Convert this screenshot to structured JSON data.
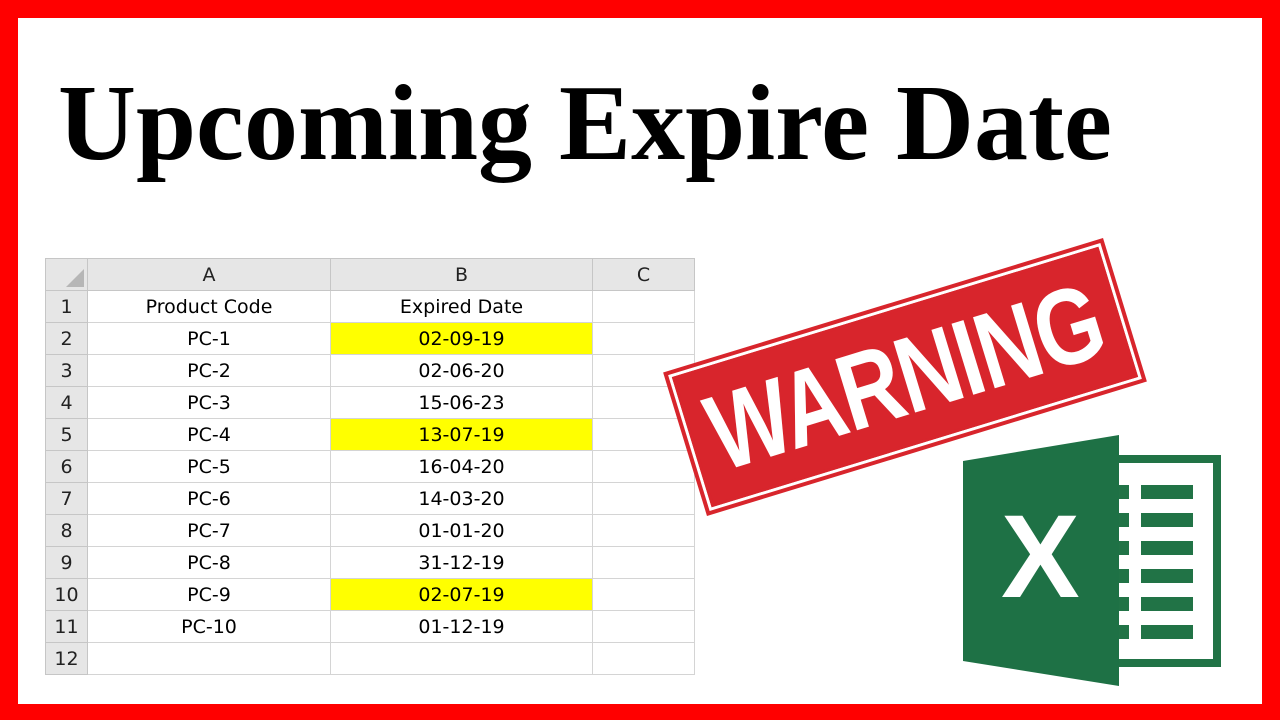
{
  "title": "Upcoming Expire Date",
  "sheet": {
    "columns": [
      "A",
      "B",
      "C"
    ],
    "header_row": {
      "num": "1",
      "a": "Product Code",
      "b": "Expired Date",
      "c": ""
    },
    "rows": [
      {
        "num": "2",
        "code": "PC-1",
        "date": "02-09-19",
        "highlight": true
      },
      {
        "num": "3",
        "code": "PC-2",
        "date": "02-06-20",
        "highlight": false
      },
      {
        "num": "4",
        "code": "PC-3",
        "date": "15-06-23",
        "highlight": false
      },
      {
        "num": "5",
        "code": "PC-4",
        "date": "13-07-19",
        "highlight": true
      },
      {
        "num": "6",
        "code": "PC-5",
        "date": "16-04-20",
        "highlight": false
      },
      {
        "num": "7",
        "code": "PC-6",
        "date": "14-03-20",
        "highlight": false
      },
      {
        "num": "8",
        "code": "PC-7",
        "date": "01-01-20",
        "highlight": false
      },
      {
        "num": "9",
        "code": "PC-8",
        "date": "31-12-19",
        "highlight": false
      },
      {
        "num": "10",
        "code": "PC-9",
        "date": "02-07-19",
        "highlight": true
      },
      {
        "num": "11",
        "code": "PC-10",
        "date": "01-12-19",
        "highlight": false
      },
      {
        "num": "12",
        "code": "",
        "date": "",
        "highlight": false
      }
    ],
    "highlight_color": "#ffff00"
  },
  "stamp": {
    "text": "WARNING",
    "color": "#d8252c"
  },
  "logo": {
    "icon": "excel-logo-icon",
    "letter": "X",
    "color": "#217346"
  },
  "colors": {
    "border": "#ff0000"
  }
}
